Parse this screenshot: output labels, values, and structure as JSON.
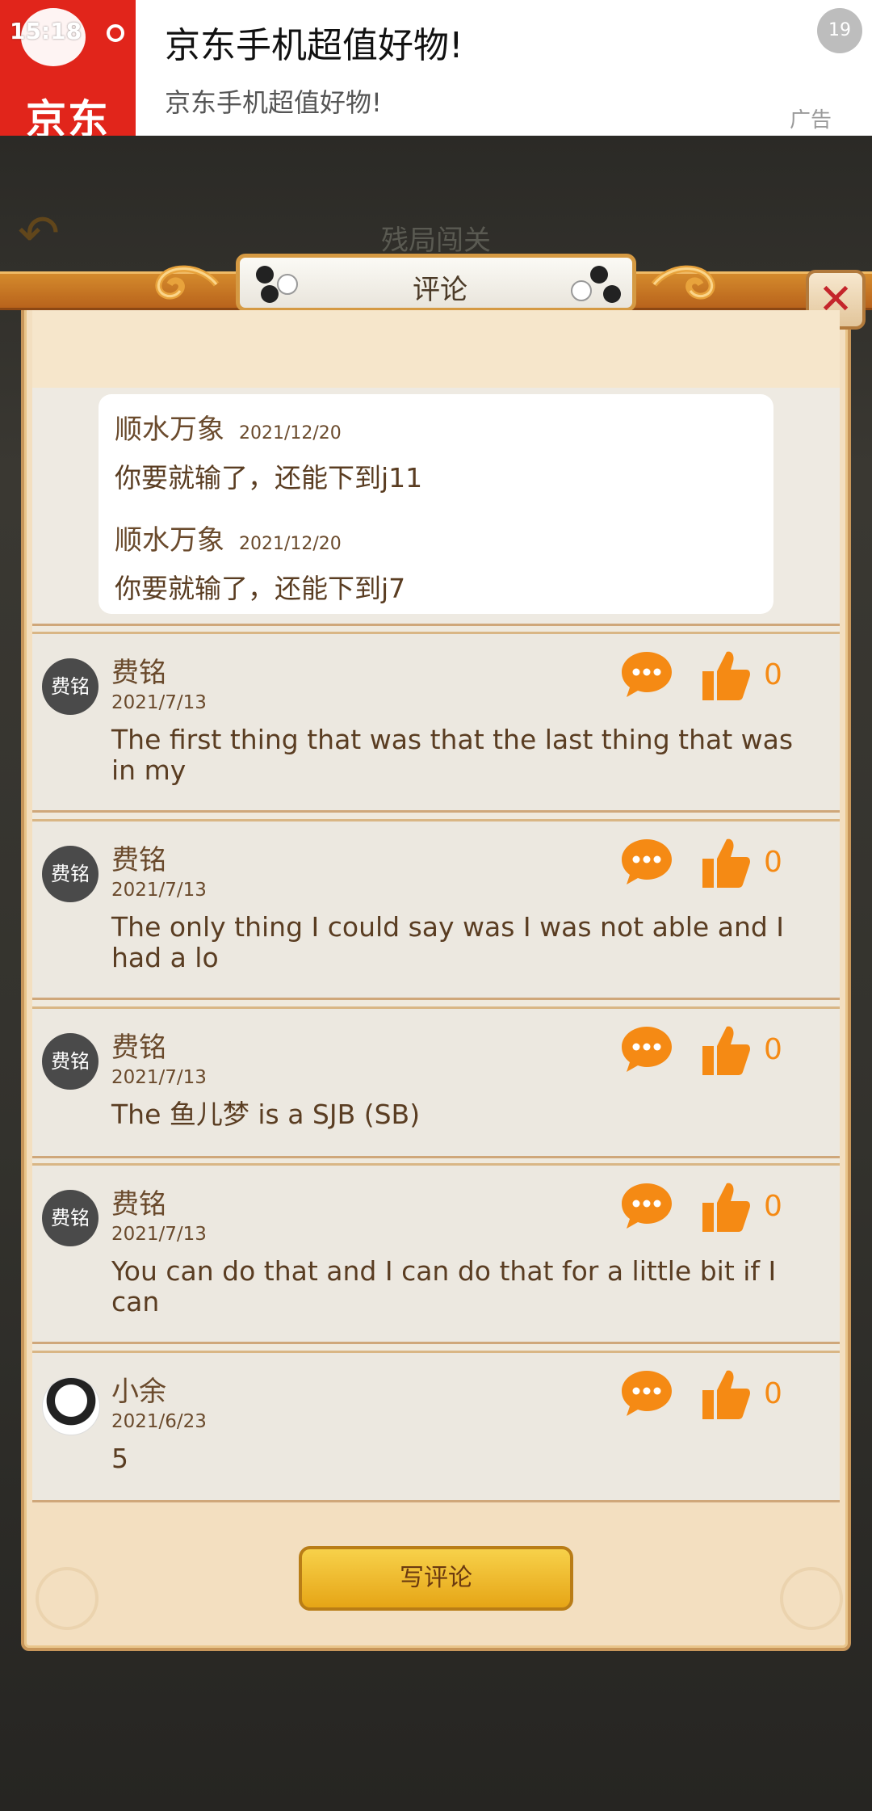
{
  "ad": {
    "time": "15:18",
    "brand": "京东",
    "title": "京东手机超值好物!",
    "subtitle": "京东手机超值好物!",
    "close_countdown": "19",
    "tag": "广告"
  },
  "background_title": "残局闯关",
  "dialog": {
    "title": "评论",
    "close_symbol": "✕",
    "write_button": "写评论"
  },
  "replies": [
    {
      "name": "顺水万象",
      "date": "2021/12/20",
      "text": "你要就输了，还能下到j11"
    },
    {
      "name": "顺水万象",
      "date": "2021/12/20",
      "text": "你要就输了，还能下到j7"
    }
  ],
  "comments": [
    {
      "avatar_text": "费铭",
      "name": "费铭",
      "date": "2021/7/13",
      "text": "The first thing that was that the last thing that was in my",
      "likes": "0"
    },
    {
      "avatar_text": "费铭",
      "name": "费铭",
      "date": "2021/7/13",
      "text": "The only thing I could say was I was not able and I had a lo",
      "likes": "0"
    },
    {
      "avatar_text": "费铭",
      "name": "费铭",
      "date": "2021/7/13",
      "text": "The 鱼儿梦 is a SJB (SB)",
      "likes": "0"
    },
    {
      "avatar_text": "费铭",
      "name": "费铭",
      "date": "2021/7/13",
      "text": "You can do that and I can do that for a little bit if I can",
      "likes": "0"
    },
    {
      "avatar_text": "",
      "name": "小余",
      "date": "2021/6/23",
      "text": "5",
      "likes": "0"
    }
  ],
  "colors": {
    "accent_orange": "#f58a14",
    "ad_red": "#e1251b",
    "close_red": "#c4252b"
  }
}
